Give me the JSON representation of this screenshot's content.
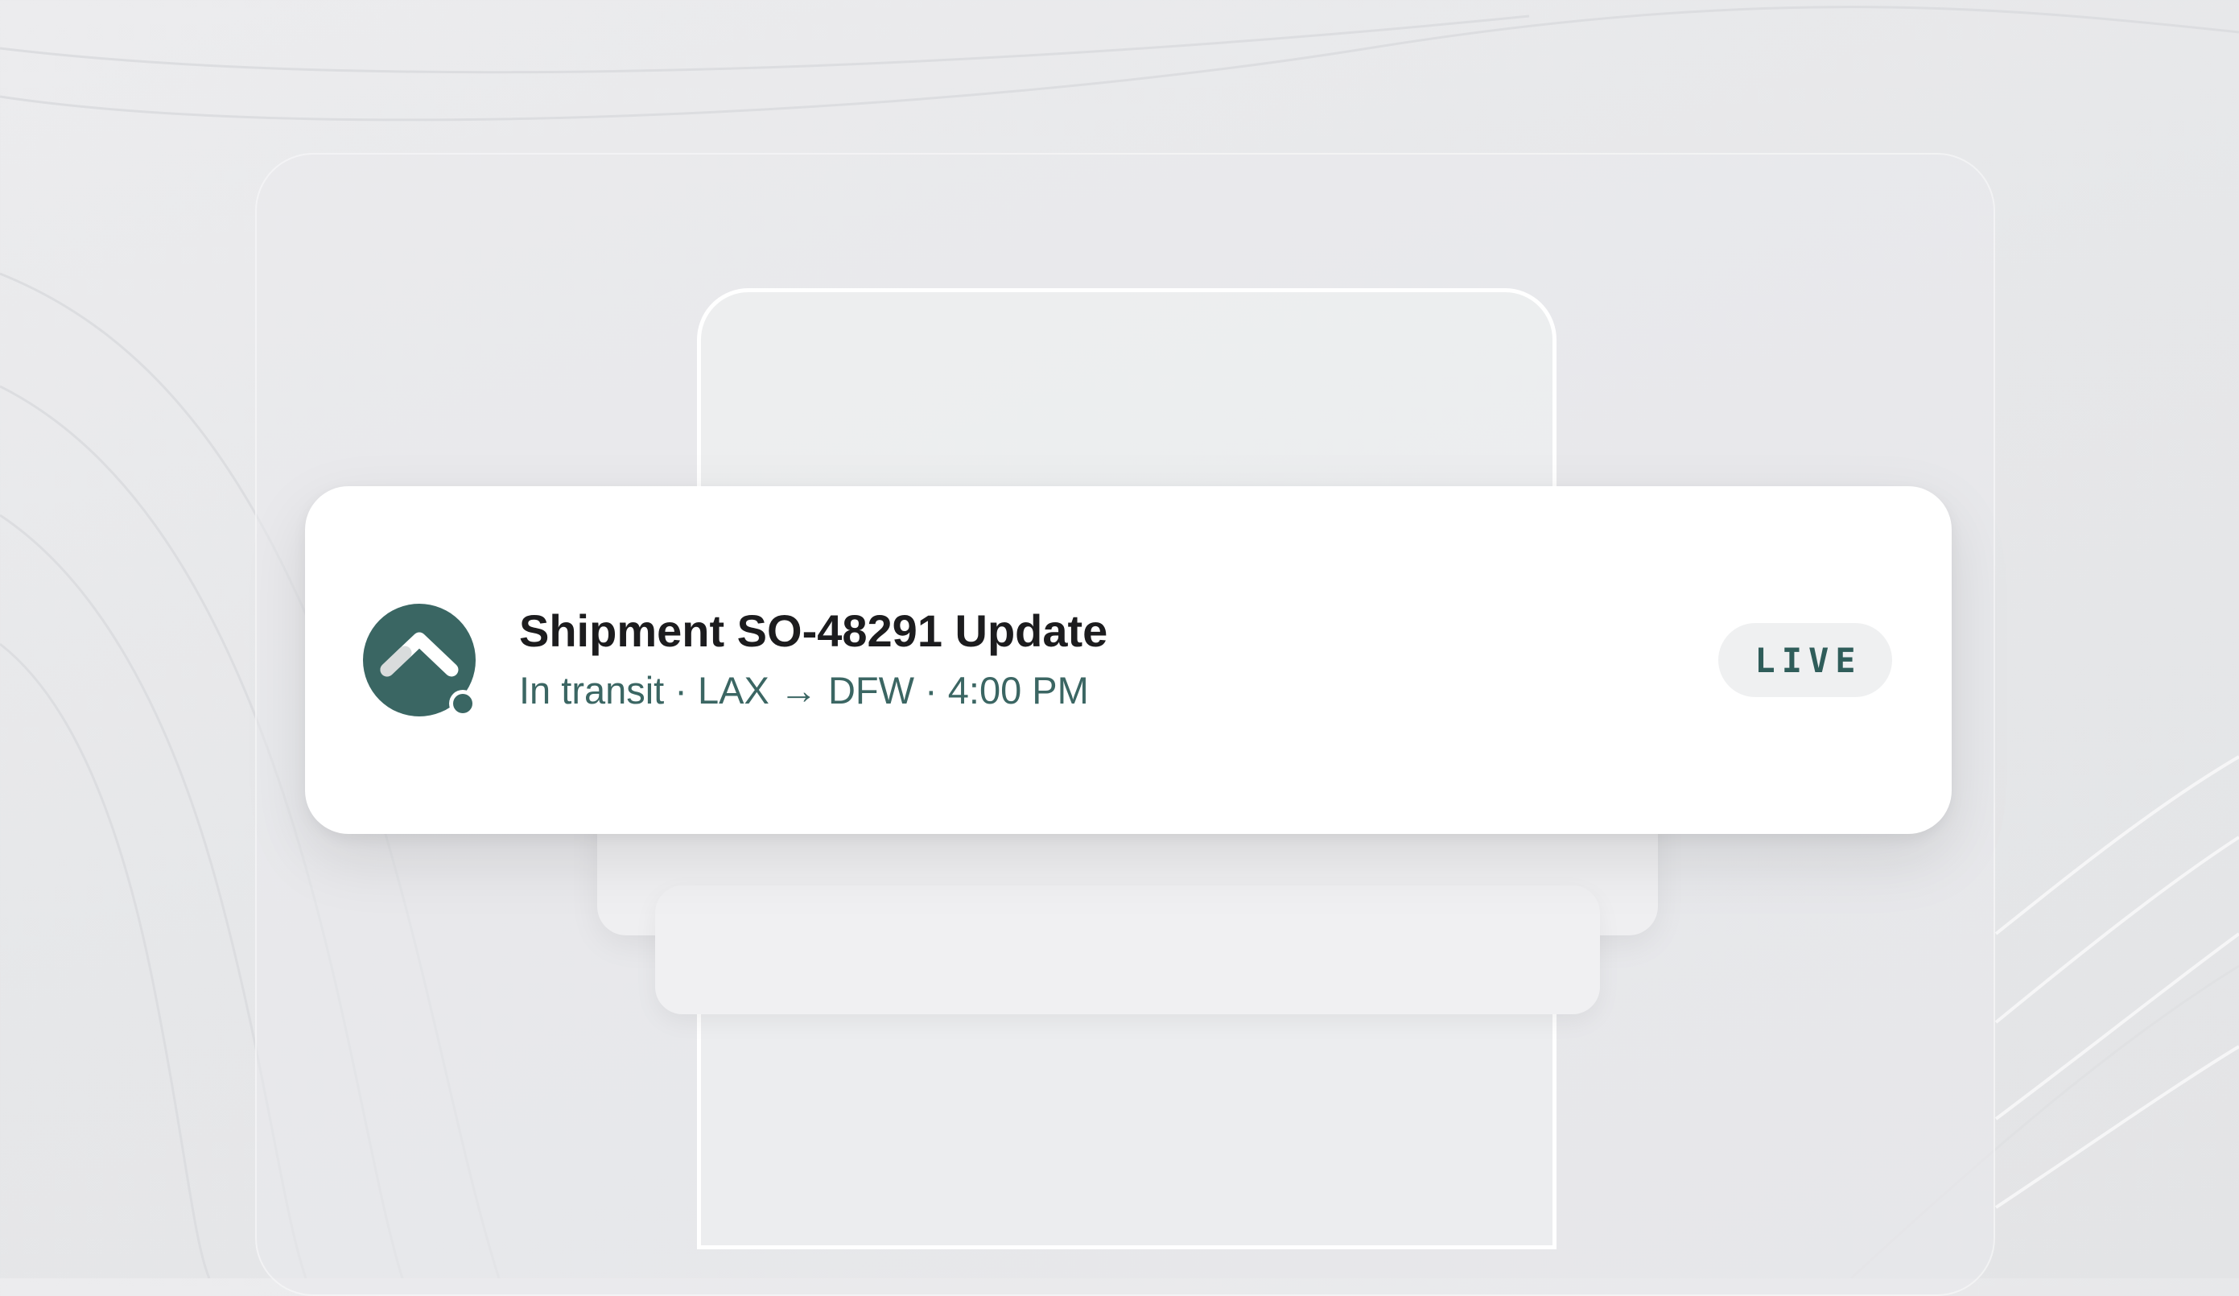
{
  "notification": {
    "app_icon": "chevron-up-app-icon",
    "title": "Shipment SO-48291 Update",
    "subtitle": "In transit · LAX → DFW · 4:00 PM",
    "badge": "LIVE"
  },
  "colors": {
    "accent": "#3b6663",
    "icon_bg": "#3a6663",
    "badge_bg": "#eff0f1",
    "title": "#1c1c1e",
    "page_bg": "#e7e8ea"
  }
}
